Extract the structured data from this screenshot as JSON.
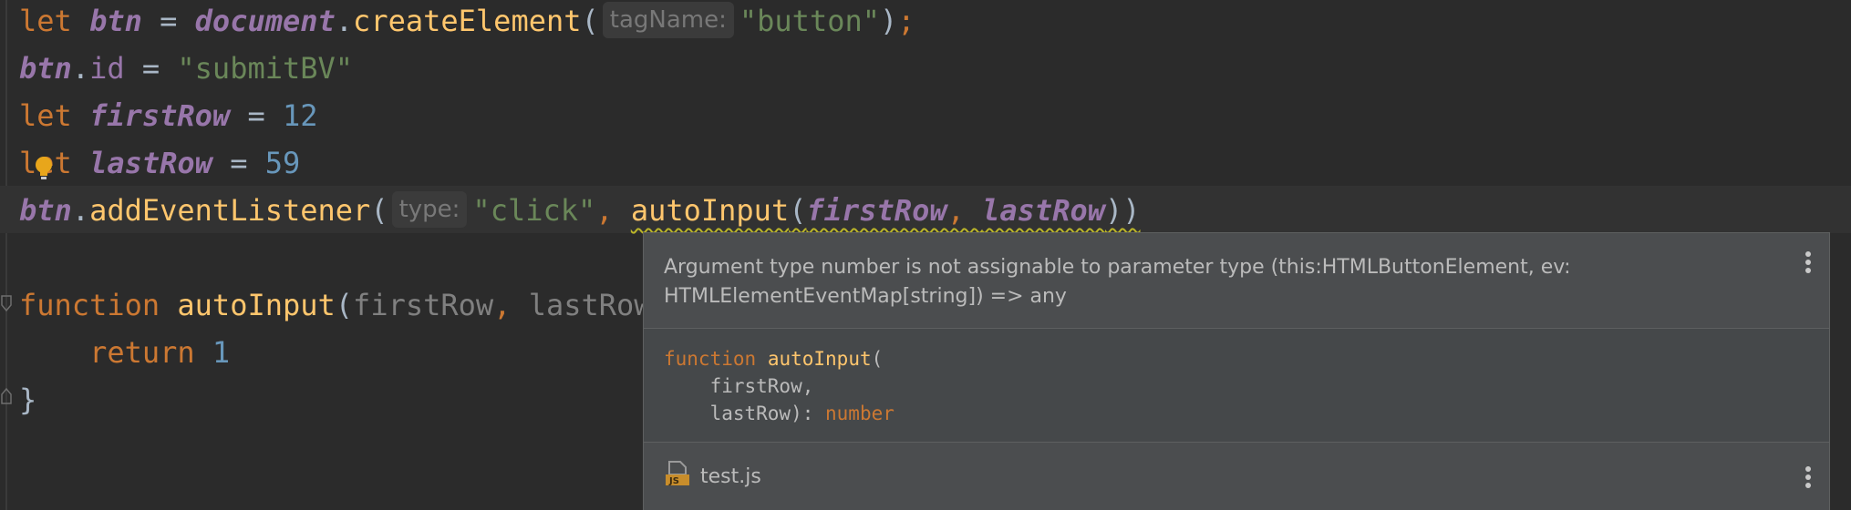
{
  "editor": {
    "line1": {
      "kw": "let",
      "var": "btn",
      "eq": " = ",
      "obj": "document",
      "dot": ".",
      "method": "createElement",
      "open": "(",
      "hint": "tagName:",
      "arg": "\"button\"",
      "close": ")",
      "semi": ";"
    },
    "line2": {
      "var": "btn",
      "dot": ".",
      "prop": "id",
      "eq": " = ",
      "val": "\"submitBV\""
    },
    "line3": {
      "kw": "let",
      "var": "firstRow",
      "eq": " = ",
      "num": "12"
    },
    "line4": {
      "kw": "let",
      "var": "lastRow",
      "eq": " = ",
      "num": "59"
    },
    "line5": {
      "var": "btn",
      "dot": ".",
      "method": "addEventListener",
      "open": "(",
      "hint": "type:",
      "arg": "\"click\"",
      "comma": ", ",
      "fn": "autoInput",
      "fn_open": "(",
      "a1": "firstRow",
      "sep": ", ",
      "a2": "lastRow",
      "close": "))"
    },
    "line7": {
      "kw": "function",
      "fn": "autoInput",
      "open": "(",
      "p1": "firstRow",
      "sep": ", ",
      "p2": "lastRow"
    },
    "line8": {
      "kw": "return",
      "num": "1"
    },
    "line9": {
      "brace": "}"
    }
  },
  "popup": {
    "message": "Argument type number is not assignable to parameter type (this:HTMLButtonElement, ev: HTMLElementEventMap[string]) => any",
    "signature": {
      "kw": "function",
      "fn": "autoInput",
      "open": "(",
      "p1": "firstRow,",
      "p2": "lastRow): ",
      "ret": "number"
    },
    "file": {
      "icon": "js-file-icon",
      "name": "test.js"
    }
  },
  "colors": {
    "background": "#2b2b2b",
    "keyword": "#cc7832",
    "variable": "#9876aa",
    "string": "#6a8759",
    "number": "#6897bb",
    "function": "#ffc66d",
    "popup_bg": "#4b4d4f"
  }
}
